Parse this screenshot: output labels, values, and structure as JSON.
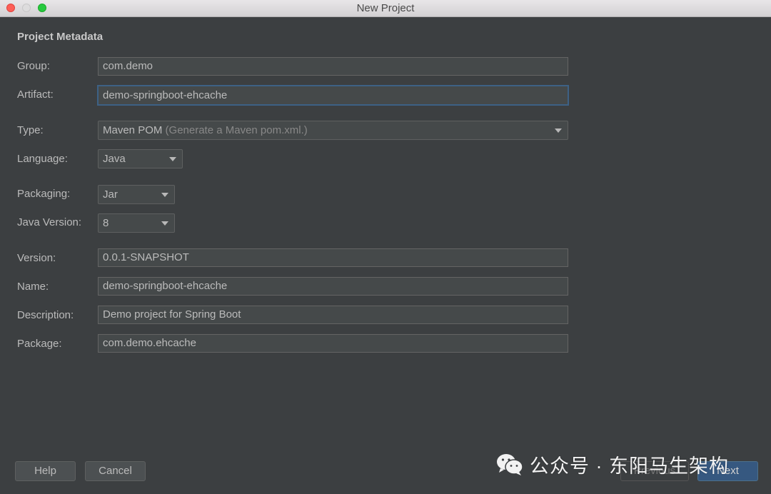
{
  "window": {
    "title": "New Project"
  },
  "section_title": "Project Metadata",
  "fields": {
    "group": {
      "label": "Group:",
      "value": "com.demo"
    },
    "artifact": {
      "label": "Artifact:",
      "value": "demo-springboot-ehcache"
    },
    "type": {
      "label": "Type:",
      "value": "Maven POM",
      "hint": "(Generate a Maven pom.xml.)"
    },
    "language": {
      "label": "Language:",
      "value": "Java"
    },
    "packaging": {
      "label": "Packaging:",
      "value": "Jar"
    },
    "java_version": {
      "label": "Java Version:",
      "value": "8"
    },
    "version": {
      "label": "Version:",
      "value": "0.0.1-SNAPSHOT"
    },
    "name": {
      "label": "Name:",
      "value": "demo-springboot-ehcache"
    },
    "description": {
      "label": "Description:",
      "value": "Demo project for Spring Boot"
    },
    "package": {
      "label": "Package:",
      "value": "com.demo.ehcache"
    }
  },
  "buttons": {
    "help": "Help",
    "cancel": "Cancel",
    "previous": "Previous",
    "next": "Next"
  },
  "watermark": {
    "text": "公众号 · 东阳马生架构",
    "icon": "wechat-icon"
  },
  "colors": {
    "background": "#3c3f41",
    "focus_border": "#3d6185",
    "primary_button": "#365880"
  }
}
